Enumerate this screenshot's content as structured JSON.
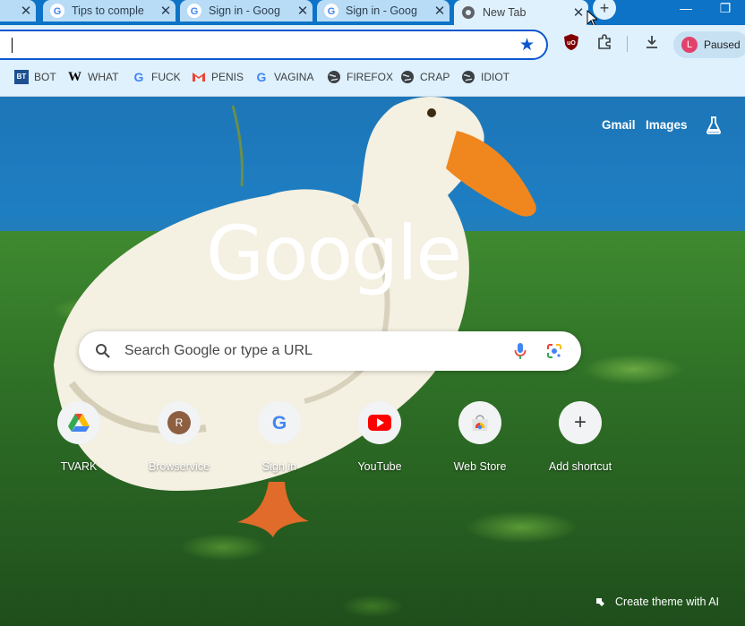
{
  "tabs": [
    {
      "title": "",
      "close": "✕"
    },
    {
      "title": "Tips to comple",
      "close": "✕"
    },
    {
      "title": "Sign in - Goog",
      "close": "✕"
    },
    {
      "title": "Sign in - Goog",
      "close": "✕"
    },
    {
      "title": "New Tab",
      "close": "✕",
      "active": true
    }
  ],
  "new_tab_symbol": "+",
  "window_controls": {
    "minimize": "—",
    "maximize": "❐"
  },
  "omnibox": {
    "value": "",
    "bookmark_icon": "star-icon"
  },
  "toolbar_icons": [
    "ublock-icon",
    "extensions-icon",
    "download-icon"
  ],
  "profile": {
    "initial": "L",
    "label": "Paused",
    "color": "#e2426b"
  },
  "bookmarks": [
    {
      "label": "BOT",
      "icon": "bt-icon"
    },
    {
      "label": "WHAT",
      "icon": "w-icon"
    },
    {
      "label": "FUCK",
      "icon": "google-icon"
    },
    {
      "label": "PENIS",
      "icon": "gmail-icon"
    },
    {
      "label": "VAGINA",
      "icon": "google-icon"
    },
    {
      "label": "FIREFOX",
      "icon": "globe-icon"
    },
    {
      "label": "CRAP",
      "icon": "globe-icon"
    },
    {
      "label": "IDIOT",
      "icon": "globe-icon"
    }
  ],
  "ntp": {
    "links": {
      "gmail": "Gmail",
      "images": "Images"
    },
    "logo": "Google",
    "search_placeholder": "Search Google or type a URL",
    "shortcuts": [
      {
        "label": "TVARK",
        "icon": "drive-triangle-icon"
      },
      {
        "label": "Browservice",
        "icon": "r-avatar-icon",
        "initial": "R"
      },
      {
        "label": "Sign in",
        "icon": "google-icon"
      },
      {
        "label": "YouTube",
        "icon": "youtube-icon"
      },
      {
        "label": "Web Store",
        "icon": "webstore-icon"
      },
      {
        "label": "Add shortcut",
        "icon": "plus-icon",
        "symbol": "+"
      }
    ],
    "create_theme": "Create theme with AI"
  },
  "colors": {
    "accent": "#0b57d0",
    "tab_bg": "#b8dcf5",
    "toolbar_bg": "#dff1fd",
    "strip_bg": "#0d73c7"
  }
}
